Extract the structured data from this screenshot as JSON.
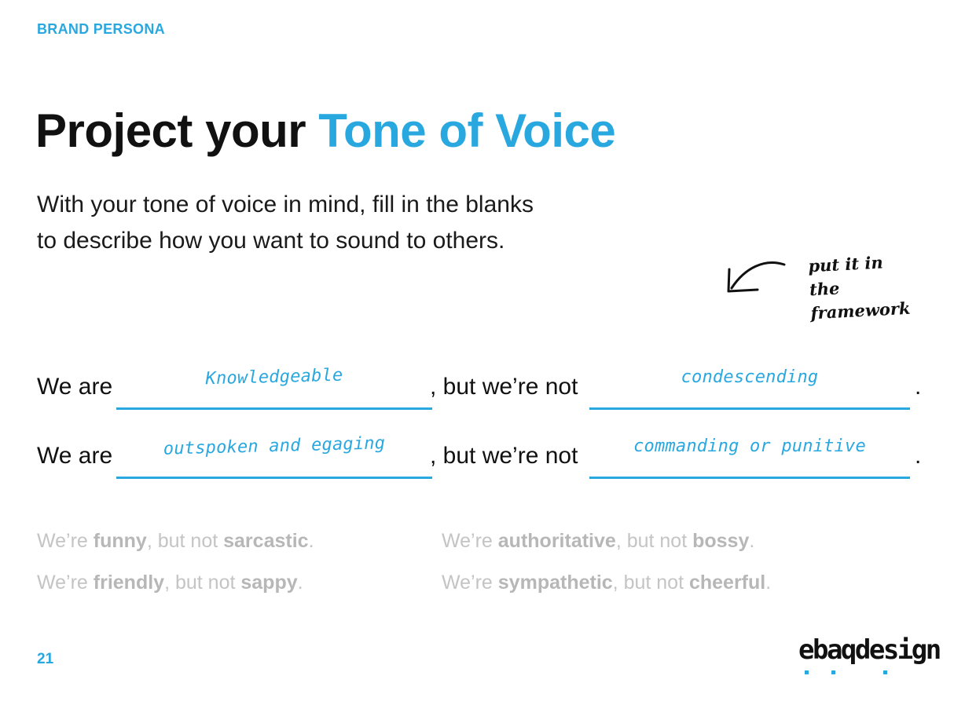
{
  "header": {
    "section_label": "BRAND PERSONA"
  },
  "title": {
    "prefix": "Project your",
    "highlight": "Tone of Voice"
  },
  "intro": {
    "line1": "With your tone of voice in mind, fill in the blanks",
    "line2": "to describe how you want to sound to others."
  },
  "hint": {
    "text": "put it in the framework",
    "icon": "curved-arrow-icon"
  },
  "framework": {
    "lead_text": "We are",
    "middle_text": ", but we’re not",
    "end_text": ".",
    "rows": [
      {
        "we_are": "Knowledgeable",
        "not": "condescending"
      },
      {
        "we_are": "outspoken and egaging",
        "not": "commanding or punitive"
      }
    ]
  },
  "examples": [
    {
      "prefix": "We’re ",
      "trait": "funny",
      "middle": ", but not ",
      "avoid": "sarcastic",
      "end": "."
    },
    {
      "prefix": "We’re ",
      "trait": "friendly",
      "middle": ", but not ",
      "avoid": "sappy",
      "end": "."
    },
    {
      "prefix": "We’re ",
      "trait": "authoritative",
      "middle": ", but not ",
      "avoid": "bossy",
      "end": "."
    },
    {
      "prefix": "We’re ",
      "trait": "sympathetic",
      "middle": ", but not ",
      "avoid": "cheerful",
      "end": "."
    }
  ],
  "footer": {
    "page_number": "21",
    "logo": "ebaqdesign"
  },
  "colors": {
    "accent": "#29a8e0",
    "text": "#111111",
    "muted": "#c4c4c4"
  }
}
